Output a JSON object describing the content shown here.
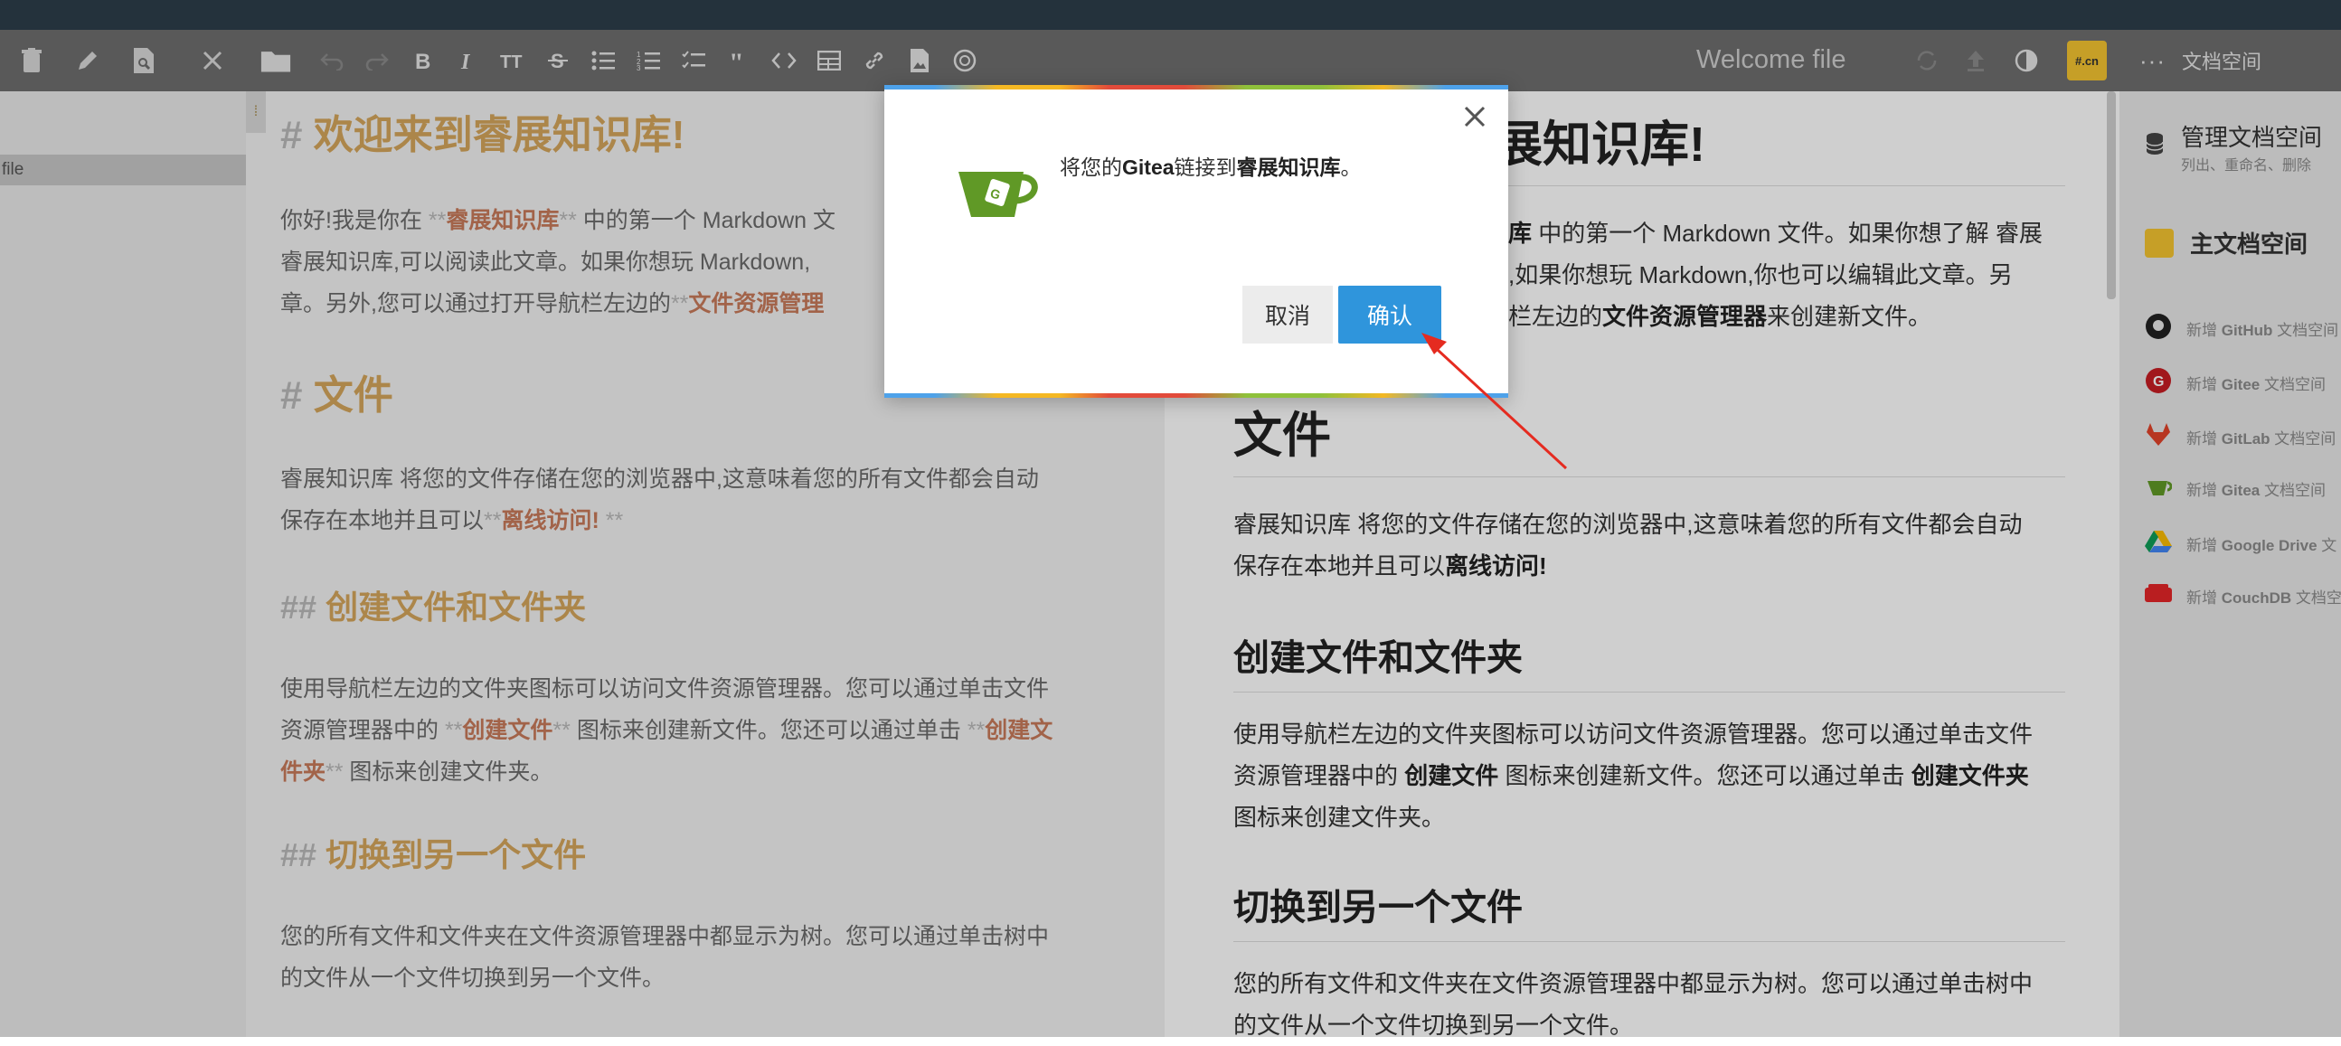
{
  "nav": {
    "title": "Welcome file",
    "workspace_label": "文档空间",
    "workspace_badge": "#.cn"
  },
  "left": {
    "file_label": "file"
  },
  "editor": {
    "h1_mark": "#",
    "h1": "欢迎来到睿展知识库!",
    "p1_l1a": "你好!我是你在 ",
    "p1_l1m": "**",
    "p1_l1s": "睿展知识库",
    "p1_l1m2": "**",
    "p1_l1b": " 中的第一个 Markdown 文",
    "p1_l2": "睿展知识库,可以阅读此文章。如果你想玩 Markdown,",
    "p1_l3a": "章。另外,您可以通过打开导航栏左边的",
    "p1_l3m": "**",
    "p1_l3s": "文件资源管理",
    "h2a_mark": "#",
    "h2a": "文件",
    "p2_l1": "睿展知识库 将您的文件存储在您的浏览器中,这意味着您的所有文件都会自动",
    "p2_l2a": "保存在本地并且可以",
    "p2_l2m": "**",
    "p2_l2s": "离线访问!",
    "p2_l2m2": " **",
    "h3a_mark": "##",
    "h3a": "创建文件和文件夹",
    "p3_l1": "使用导航栏左边的文件夹图标可以访问文件资源管理器。您可以通过单击文件",
    "p3_l2a": "资源管理器中的 ",
    "p3_l2m": "**",
    "p3_l2s": "创建文件",
    "p3_l2m2": "**",
    "p3_l2b": " 图标来创建新文件。您还可以通过单击 ",
    "p3_l2m3": "**",
    "p3_l2s2": "创建文",
    "p3_l3s": "件夹",
    "p3_l3m": "**",
    "p3_l3b": " 图标来创建文件夹。",
    "h3b_mark": "##",
    "h3b": "切换到另一个文件",
    "p4_l1": "您的所有文件和文件夹在文件资源管理器中都显示为树。您可以通过单击树中",
    "p4_l2": "的文件从一个文件切换到另一个文件。"
  },
  "preview": {
    "h1": "展知识库!",
    "p1_l1a": "库",
    "p1_l1b": " 中的第一个 Markdown 文件。如果你想了解 睿展",
    "p1_l2": ",如果你想玩 Markdown,你也可以编辑此文章。另",
    "p1_l3a": "栏左边的",
    "p1_l3b": "文件资源管理器",
    "p1_l3c": "来创建新文件。",
    "h2a": "文件",
    "p2_l1": "睿展知识库 将您的文件存储在您的浏览器中,这意味着您的所有文件都会自动",
    "p2_l2a": "保存在本地并且可以",
    "p2_l2b": "离线访问!",
    "h3a": "创建文件和文件夹",
    "p3_l1": "使用导航栏左边的文件夹图标可以访问文件资源管理器。您可以通过单击文件",
    "p3_l2a": "资源管理器中的 ",
    "p3_l2b": "创建文件",
    "p3_l2c": " 图标来创建新文件。您还可以通过单击 ",
    "p3_l2d": "创建文件夹",
    "p3_l3": "图标来创建文件夹。",
    "h3b": "切换到另一个文件",
    "p4_l1": "您的所有文件和文件夹在文件资源管理器中都显示为树。您可以通过单击树中",
    "p4_l2": "的文件从一个文件切换到另一个文件。"
  },
  "right": {
    "manage_title": "管理文档空间",
    "manage_sub": "列出、重命名、删除",
    "main_ws": "主文档空间",
    "items": [
      {
        "prefix": "新增 ",
        "name": "GitHub",
        "suffix": " 文档空间"
      },
      {
        "prefix": "新增 ",
        "name": "Gitee",
        "suffix": " 文档空间"
      },
      {
        "prefix": "新增 ",
        "name": "GitLab",
        "suffix": " 文档空间"
      },
      {
        "prefix": "新增 ",
        "name": "Gitea",
        "suffix": " 文档空间"
      },
      {
        "prefix": "新增 ",
        "name": "Google Drive",
        "suffix": " 文"
      },
      {
        "prefix": "新增 ",
        "name": "CouchDB",
        "suffix": " 文档空"
      }
    ]
  },
  "dialog": {
    "text_a": "将您的",
    "text_b": "Gitea",
    "text_c": "链接到",
    "text_d": "睿展知识库",
    "text_e": "。",
    "cancel": "取消",
    "confirm": "确认"
  },
  "colors": {
    "accent": "#2f95dc",
    "heading_md": "#d4a55c",
    "strong_md": "#c87a5a",
    "gitea_green": "#609926"
  }
}
